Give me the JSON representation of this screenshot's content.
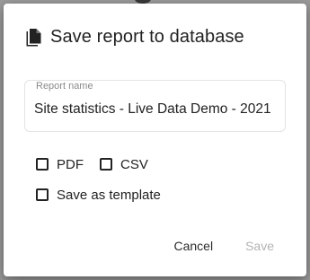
{
  "dialog": {
    "title": "Save report to database",
    "title_icon": "file-copy-icon"
  },
  "report_name": {
    "label": "Report name",
    "value": "Site statistics - Live Data Demo - 2021"
  },
  "options": {
    "pdf_label": "PDF",
    "csv_label": "CSV",
    "template_label": "Save as template"
  },
  "actions": {
    "cancel_label": "Cancel",
    "save_label": "Save"
  }
}
